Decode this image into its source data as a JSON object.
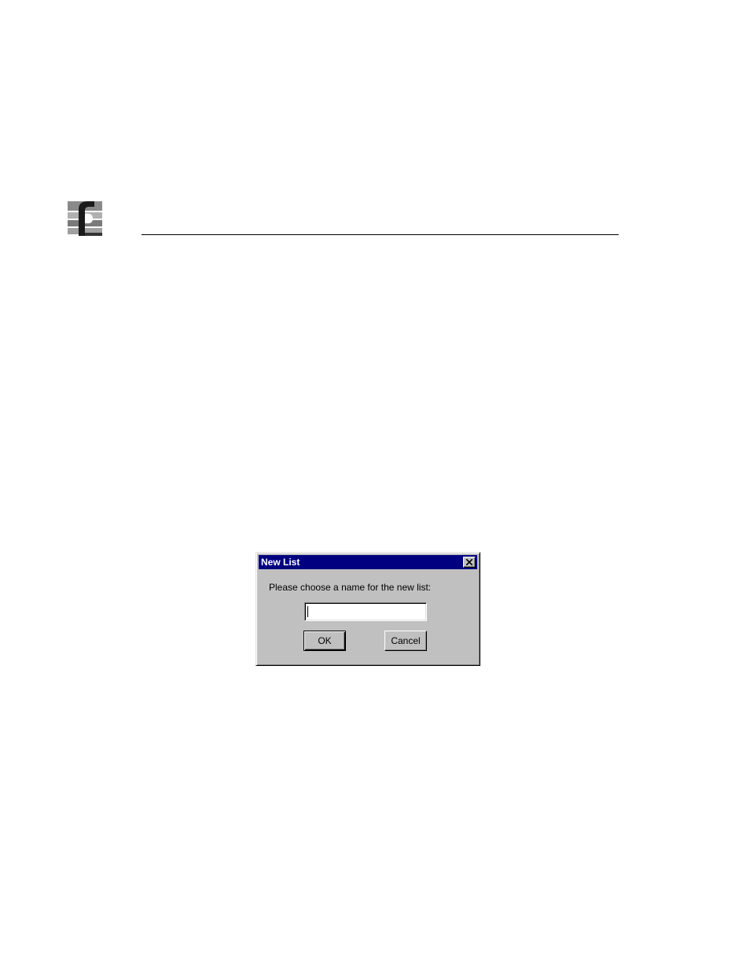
{
  "dialog": {
    "title": "New List",
    "close_icon": "close-icon",
    "prompt": "Please choose a name for the new list:",
    "input_value": "",
    "ok_label": "OK",
    "cancel_label": "Cancel"
  },
  "colors": {
    "titlebar": "#000080",
    "dialog_face": "#c0c0c0"
  },
  "icons": {
    "logo": "company-logo-icon"
  }
}
